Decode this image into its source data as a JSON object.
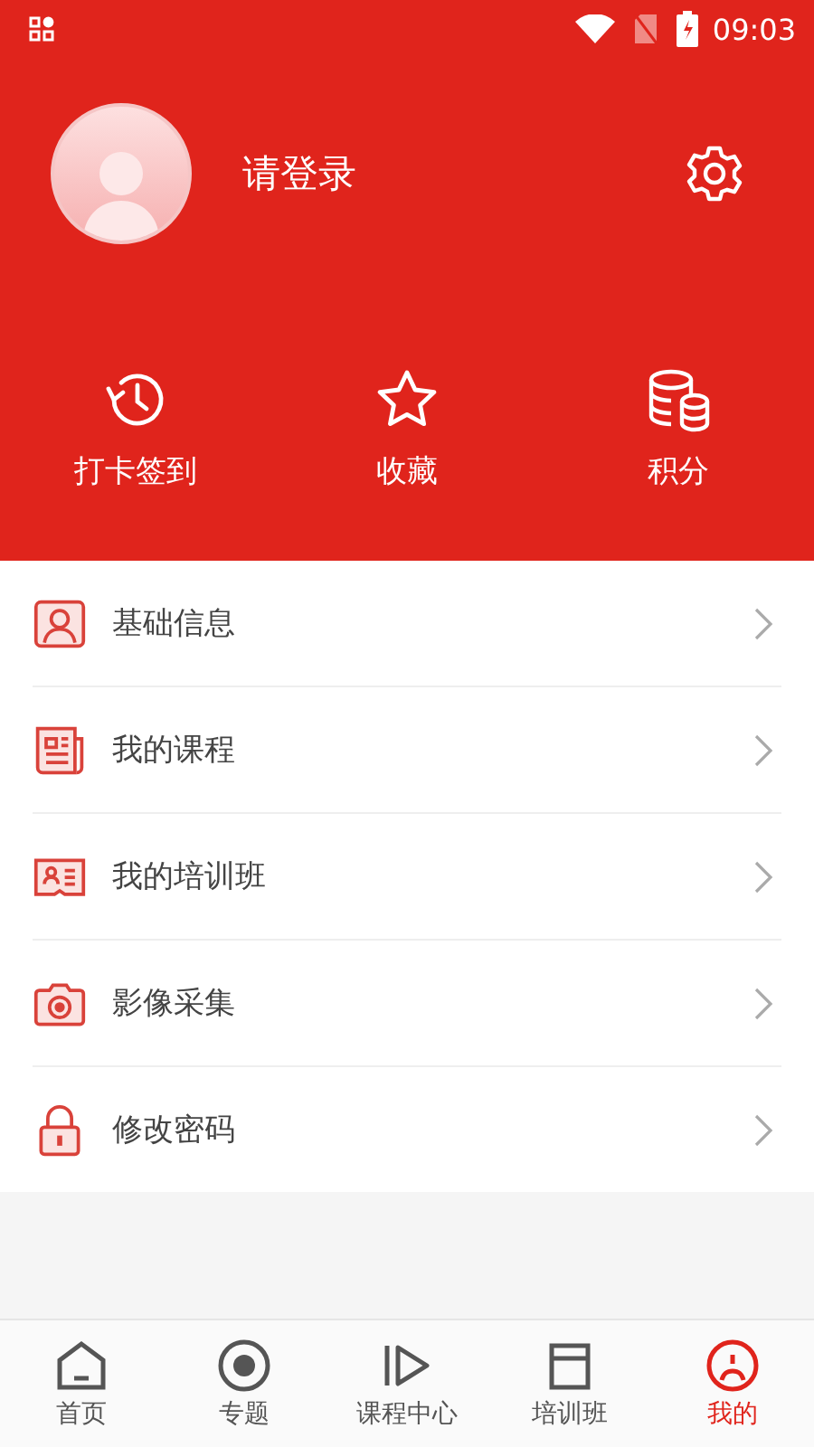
{
  "status_bar": {
    "time": "09:03"
  },
  "profile": {
    "login_prompt": "请登录"
  },
  "actions": [
    {
      "kind": "history",
      "label": "打卡签到"
    },
    {
      "kind": "star",
      "label": "收藏"
    },
    {
      "kind": "coins",
      "label": "积分"
    }
  ],
  "menu": [
    {
      "kind": "profile",
      "label": "基础信息"
    },
    {
      "kind": "courses",
      "label": "我的课程"
    },
    {
      "kind": "idcard",
      "label": "我的培训班"
    },
    {
      "kind": "camera",
      "label": "影像采集"
    },
    {
      "kind": "lock",
      "label": "修改密码"
    }
  ],
  "nav": [
    {
      "kind": "home",
      "label": "首页",
      "selected": false
    },
    {
      "kind": "topic",
      "label": "专题",
      "selected": false
    },
    {
      "kind": "play",
      "label": "课程中心",
      "selected": false
    },
    {
      "kind": "class",
      "label": "培训班",
      "selected": false
    },
    {
      "kind": "me",
      "label": "我的",
      "selected": true
    }
  ]
}
